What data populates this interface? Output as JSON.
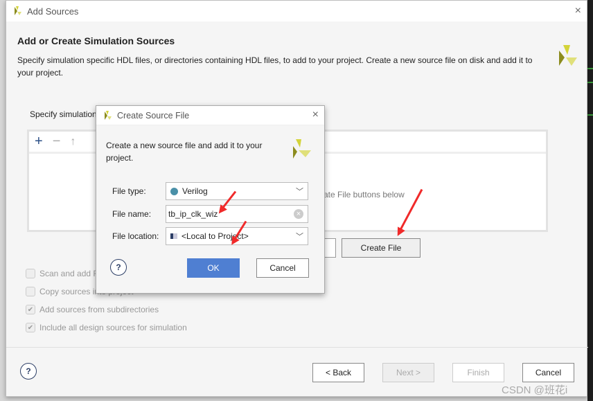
{
  "window": {
    "title": "Add Sources",
    "close": "×"
  },
  "header": {
    "title": "Add or Create Simulation Sources",
    "description": "Specify simulation specific HDL files, or directories containing HDL files, to add to your project. Create a new source file on disk and add it to your project."
  },
  "panel": {
    "label": "Specify simulation",
    "hint": "ate File buttons below",
    "toolbar": {
      "add": "+",
      "remove": "−",
      "up": "↑"
    }
  },
  "buttons": {
    "create_file": "Create File",
    "back": "< Back",
    "next": "Next >",
    "finish": "Finish",
    "cancel": "Cancel",
    "help": "?"
  },
  "options": [
    {
      "label": "Scan and add R",
      "checked": false
    },
    {
      "label": "Copy sources into project",
      "checked": false
    },
    {
      "label": "Add sources from subdirectories",
      "checked": true
    },
    {
      "label": "Include all design sources for simulation",
      "checked": true
    }
  ],
  "dialog": {
    "title": "Create Source File",
    "close": "×",
    "description": "Create a new source file and add it to your project.",
    "file_type_label": "File type:",
    "file_type": "Verilog",
    "file_name_label": "File name:",
    "file_name": "tb_ip_clk_wiz",
    "file_location_label": "File location:",
    "file_location": "<Local to Project>",
    "ok": "OK",
    "cancel": "Cancel",
    "help": "?"
  },
  "watermark": "CSDN @班花i",
  "colors": {
    "accent": "#4f7fd2",
    "verilog_dot": "#4a90a8",
    "arrow": "#f02a2a"
  }
}
